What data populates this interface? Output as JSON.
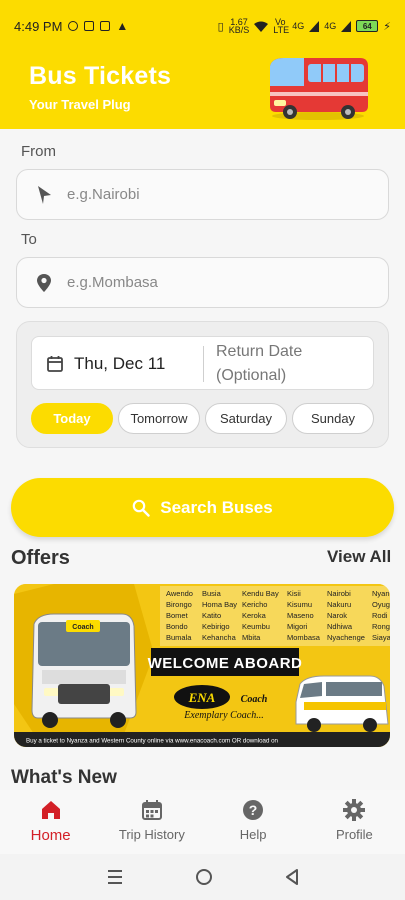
{
  "status_bar": {
    "time": "4:49 PM",
    "network_speed": "1.67\nKB/S",
    "network_labels": [
      "Vo LTE",
      "4G",
      "4G"
    ],
    "battery": "64"
  },
  "header": {
    "title": "Bus Tickets",
    "subtitle": "Your Travel Plug"
  },
  "from": {
    "label": "From",
    "placeholder": "e.g.Nairobi"
  },
  "to": {
    "label": "To",
    "placeholder": "e.g.Mombasa"
  },
  "dates": {
    "departure": "Thu, Dec 11",
    "return_placeholder": "Return Date (Optional)",
    "quick_options": [
      "Today",
      "Tomorrow",
      "Saturday",
      "Sunday"
    ],
    "selected_option": "Today"
  },
  "search_button": {
    "label": "Search Buses"
  },
  "offers": {
    "title": "Offers",
    "view_all": "View All"
  },
  "banner": {
    "brand": "ENA Coach",
    "tagline": "Exemplary Coach...",
    "headline": "WELCOME ABOARD",
    "bus_label": "Coach",
    "towns": [
      [
        "Awendo",
        "Busia",
        "Kendu Bay",
        "Kisii",
        "Nairobi",
        "Nyan"
      ],
      [
        "Birongo",
        "Homa Bay",
        "Kericho",
        "Kisumu",
        "Nakuru",
        "Oyug"
      ],
      [
        "Bomet",
        "Katito",
        "Keroka",
        "Maseno",
        "Narok",
        "Rodi"
      ],
      [
        "Bondo",
        "Kebirigo",
        "Keumbu",
        "Migori",
        "Ndhiwa",
        "Rong"
      ],
      [
        "Bumala",
        "Kehancha",
        "Mbita",
        "Mombasa",
        "Nyachenge",
        "Siaya"
      ]
    ],
    "footer_text": "Buy a ticket to Nyanza and Western County online via",
    "footer_site": "www.enacoach.com",
    "footer_or": "OR",
    "footer_download": "download on"
  },
  "whats_new": {
    "title": "What's New"
  },
  "bottom_nav": {
    "items": [
      {
        "label": "Home",
        "icon": "home-icon",
        "active": true
      },
      {
        "label": "Trip History",
        "icon": "calendar-icon",
        "active": false
      },
      {
        "label": "Help",
        "icon": "help-icon",
        "active": false
      },
      {
        "label": "Profile",
        "icon": "gear-icon",
        "active": false
      }
    ]
  },
  "colors": {
    "brand_yellow": "#fcdc00",
    "active_nav": "#d32027"
  }
}
